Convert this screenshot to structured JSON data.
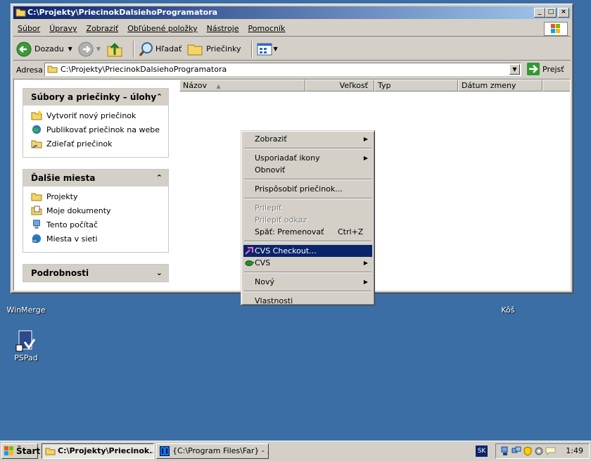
{
  "window": {
    "title": "C:\\Projekty\\PriecinokDalsiehoProgramatora",
    "min": "_",
    "max": "□",
    "close": "×"
  },
  "menu": [
    "Súbor",
    "Úpravy",
    "Zobraziť",
    "Obľúbené položky",
    "Nástroje",
    "Pomocník"
  ],
  "toolbar": {
    "back": "Dozadu",
    "search": "Hľadať",
    "folders": "Priečinky"
  },
  "address": {
    "label": "Adresa",
    "value": "C:\\Projekty\\PriecinokDalsiehoProgramatora",
    "go": "Prejsť"
  },
  "tasks": {
    "panel1": {
      "title": "Súbory a priečinky – úlohy",
      "items": [
        "Vytvoriť nový priečinok",
        "Publikovať priečinok na webe",
        "Zdieľať priečinok"
      ]
    },
    "panel2": {
      "title": "Ďalšie miesta",
      "items": [
        "Projekty",
        "Moje dokumenty",
        "Tento počítač",
        "Miesta v sieti"
      ]
    },
    "panel3": {
      "title": "Podrobnosti"
    }
  },
  "columns": [
    "Názov",
    "Veľkosť",
    "Typ",
    "Dátum zmeny"
  ],
  "context_menu": {
    "view": "Zobraziť",
    "arrange": "Usporiadať ikony",
    "refresh": "Obnoviť",
    "customize": "Prispôsobiť priečinok...",
    "paste": "Prilepiť",
    "paste_shortcut": "Prilepiť odkaz",
    "undo": "Späť: Premenovať",
    "undo_shortcut": "Ctrl+Z",
    "cvs_checkout": "CVS Checkout...",
    "cvs": "CVS",
    "new": "Nový",
    "properties": "Vlastnosti"
  },
  "desktop_icons": {
    "winmerge": "WinMerge",
    "pspad": "PSPad",
    "trash": "Kôš"
  },
  "taskbar": {
    "start": "Štart",
    "task1": "C:\\Projekty\\Priecinok...",
    "task2": "{C:\\Program Files\\Far} - ...",
    "lang": "SK",
    "clock": "1:49"
  }
}
